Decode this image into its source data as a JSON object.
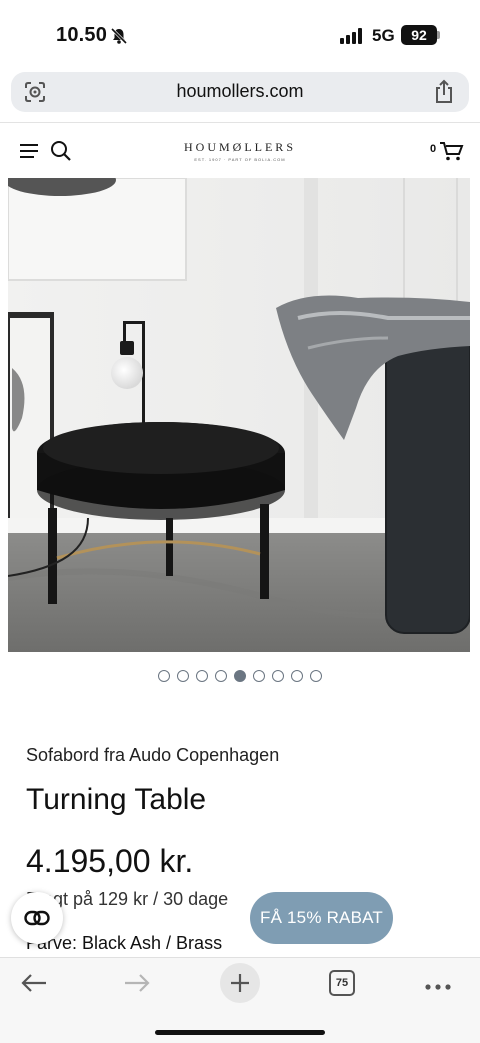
{
  "status_bar": {
    "time": "10.50",
    "network": "5G",
    "battery": "92",
    "icons": [
      "bell-slash-icon",
      "signal-bars-icon"
    ]
  },
  "browser": {
    "url": "houmollers.com",
    "icons": [
      "page-settings-icon",
      "share-icon"
    ]
  },
  "site_header": {
    "logo": "HOUMØLLERS",
    "logo_tagline": "EST. 1907 · PART OF BOLIA.COM",
    "cart_count": "0",
    "icons": [
      "menu-icon",
      "search-icon",
      "cart-icon"
    ]
  },
  "gallery": {
    "total_images": 9,
    "active_index": 4
  },
  "product": {
    "subtitle": "Sofabord fra Audo Copenhagen",
    "title": "Turning Table",
    "price": "4.195,00 kr.",
    "shipping": "Fragt på 129 kr / 30 dage",
    "color_label": "Farve: Black Ash / Brass"
  },
  "actions": {
    "discount_label": "FÅ 15% RABAT",
    "compare_icon": "compare-icon"
  },
  "toolbar": {
    "tab_count": "75",
    "icons": [
      "back-arrow-icon",
      "forward-arrow-icon",
      "plus-icon",
      "tabs-icon",
      "more-icon"
    ]
  },
  "colors": {
    "accent": "#7f9db3",
    "dot": "#6b7682",
    "url_bar": "#eaecef"
  }
}
